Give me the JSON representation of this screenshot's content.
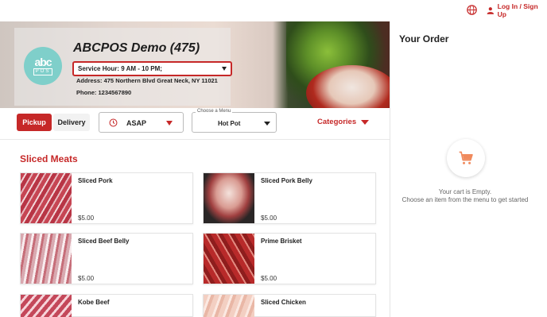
{
  "topbar": {
    "login_label": "Log In / Sign Up"
  },
  "store": {
    "logo_top": "abc",
    "logo_bottom": "POS",
    "title": "ABCPOS Demo (475)",
    "service_hour": "Service Hour: 9 AM - 10 PM;",
    "address": "Address: 475 Northern Blvd Great Neck, NY 11021",
    "phone": "Phone: 1234567890"
  },
  "controls": {
    "pickup_label": "Pickup",
    "delivery_label": "Delivery",
    "time_value": "ASAP",
    "menu_legend": "Choose a Menu",
    "menu_value": "Hot Pot",
    "categories_label": "Categories"
  },
  "section": {
    "title": "Sliced Meats"
  },
  "items": [
    {
      "name": "Sliced Pork",
      "price": "$5.00"
    },
    {
      "name": "Sliced Pork Belly",
      "price": "$5.00"
    },
    {
      "name": "Sliced Beef Belly",
      "price": "$5.00"
    },
    {
      "name": "Prime Brisket",
      "price": "$5.00"
    },
    {
      "name": "Kobe Beef",
      "price": ""
    },
    {
      "name": "Sliced Chicken",
      "price": ""
    }
  ],
  "order": {
    "title": "Your Order",
    "empty_line1": "Your cart is Empty.",
    "empty_line2": "Choose an item from the menu to get started"
  },
  "colors": {
    "accent": "#c62828",
    "cart_icon": "#f08a5d",
    "logo_bg": "#7fcfca"
  },
  "icons": [
    "globe-icon",
    "user-icon",
    "clock-icon",
    "cart-icon",
    "chevron-down-icon"
  ]
}
